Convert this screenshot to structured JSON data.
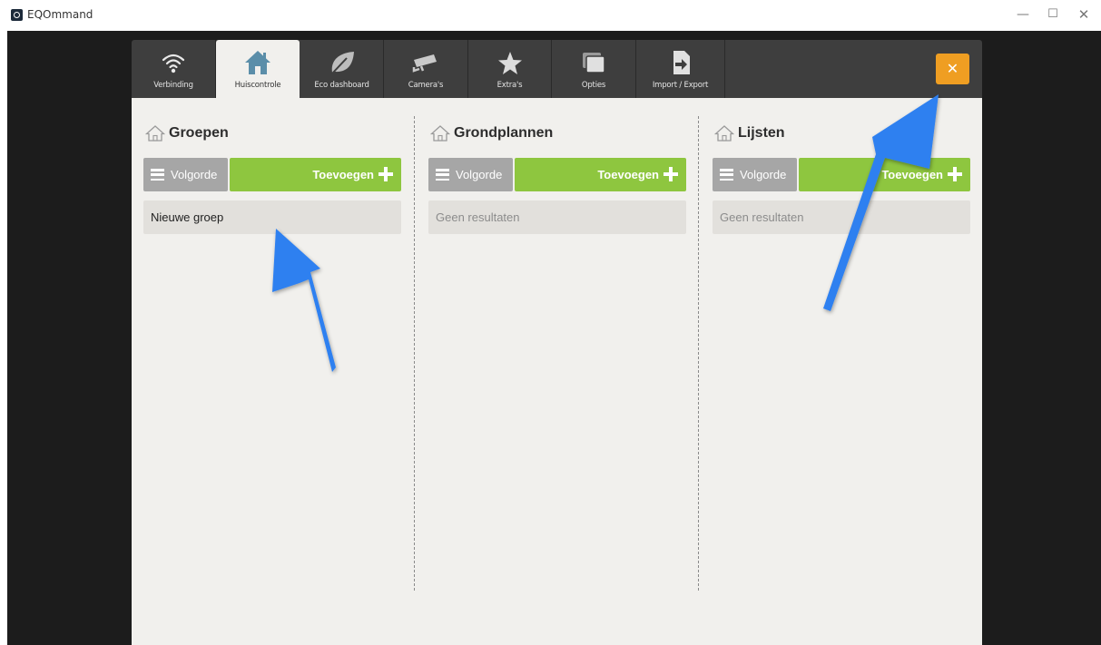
{
  "window": {
    "title": "EQOmmand",
    "controls": {
      "minimize": "—",
      "maximize": "☐",
      "close": "✕"
    }
  },
  "toolbar": {
    "tabs": [
      {
        "label": "Verbinding",
        "icon": "wifi-icon",
        "active": false
      },
      {
        "label": "Huiscontrole",
        "icon": "house-icon",
        "active": true
      },
      {
        "label": "Eco dashboard",
        "icon": "leaf-icon",
        "active": false
      },
      {
        "label": "Camera's",
        "icon": "camera-icon",
        "active": false
      },
      {
        "label": "Extra's",
        "icon": "star-icon",
        "active": false
      },
      {
        "label": "Opties",
        "icon": "windows-icon",
        "active": false
      },
      {
        "label": "Import / Export",
        "icon": "import-export-icon",
        "active": false
      }
    ],
    "close_label": "✕"
  },
  "columns": [
    {
      "title": "Groepen",
      "order_label": "Volgorde",
      "add_label": "Toevoegen",
      "row_text": "Nieuwe groep",
      "row_is_empty": false
    },
    {
      "title": "Grondplannen",
      "order_label": "Volgorde",
      "add_label": "Toevoegen",
      "row_text": "Geen resultaten",
      "row_is_empty": true
    },
    {
      "title": "Lijsten",
      "order_label": "Volgorde",
      "add_label": "Toevoegen",
      "row_text": "Geen resultaten",
      "row_is_empty": true
    }
  ],
  "colors": {
    "toolbar": "#3e3e3e",
    "content_bg": "#f1f0ed",
    "add_button": "#8ec63f",
    "order_button": "#a6a6a6",
    "close_button": "#ef9e22",
    "annotation_arrow": "#2f80f0"
  }
}
